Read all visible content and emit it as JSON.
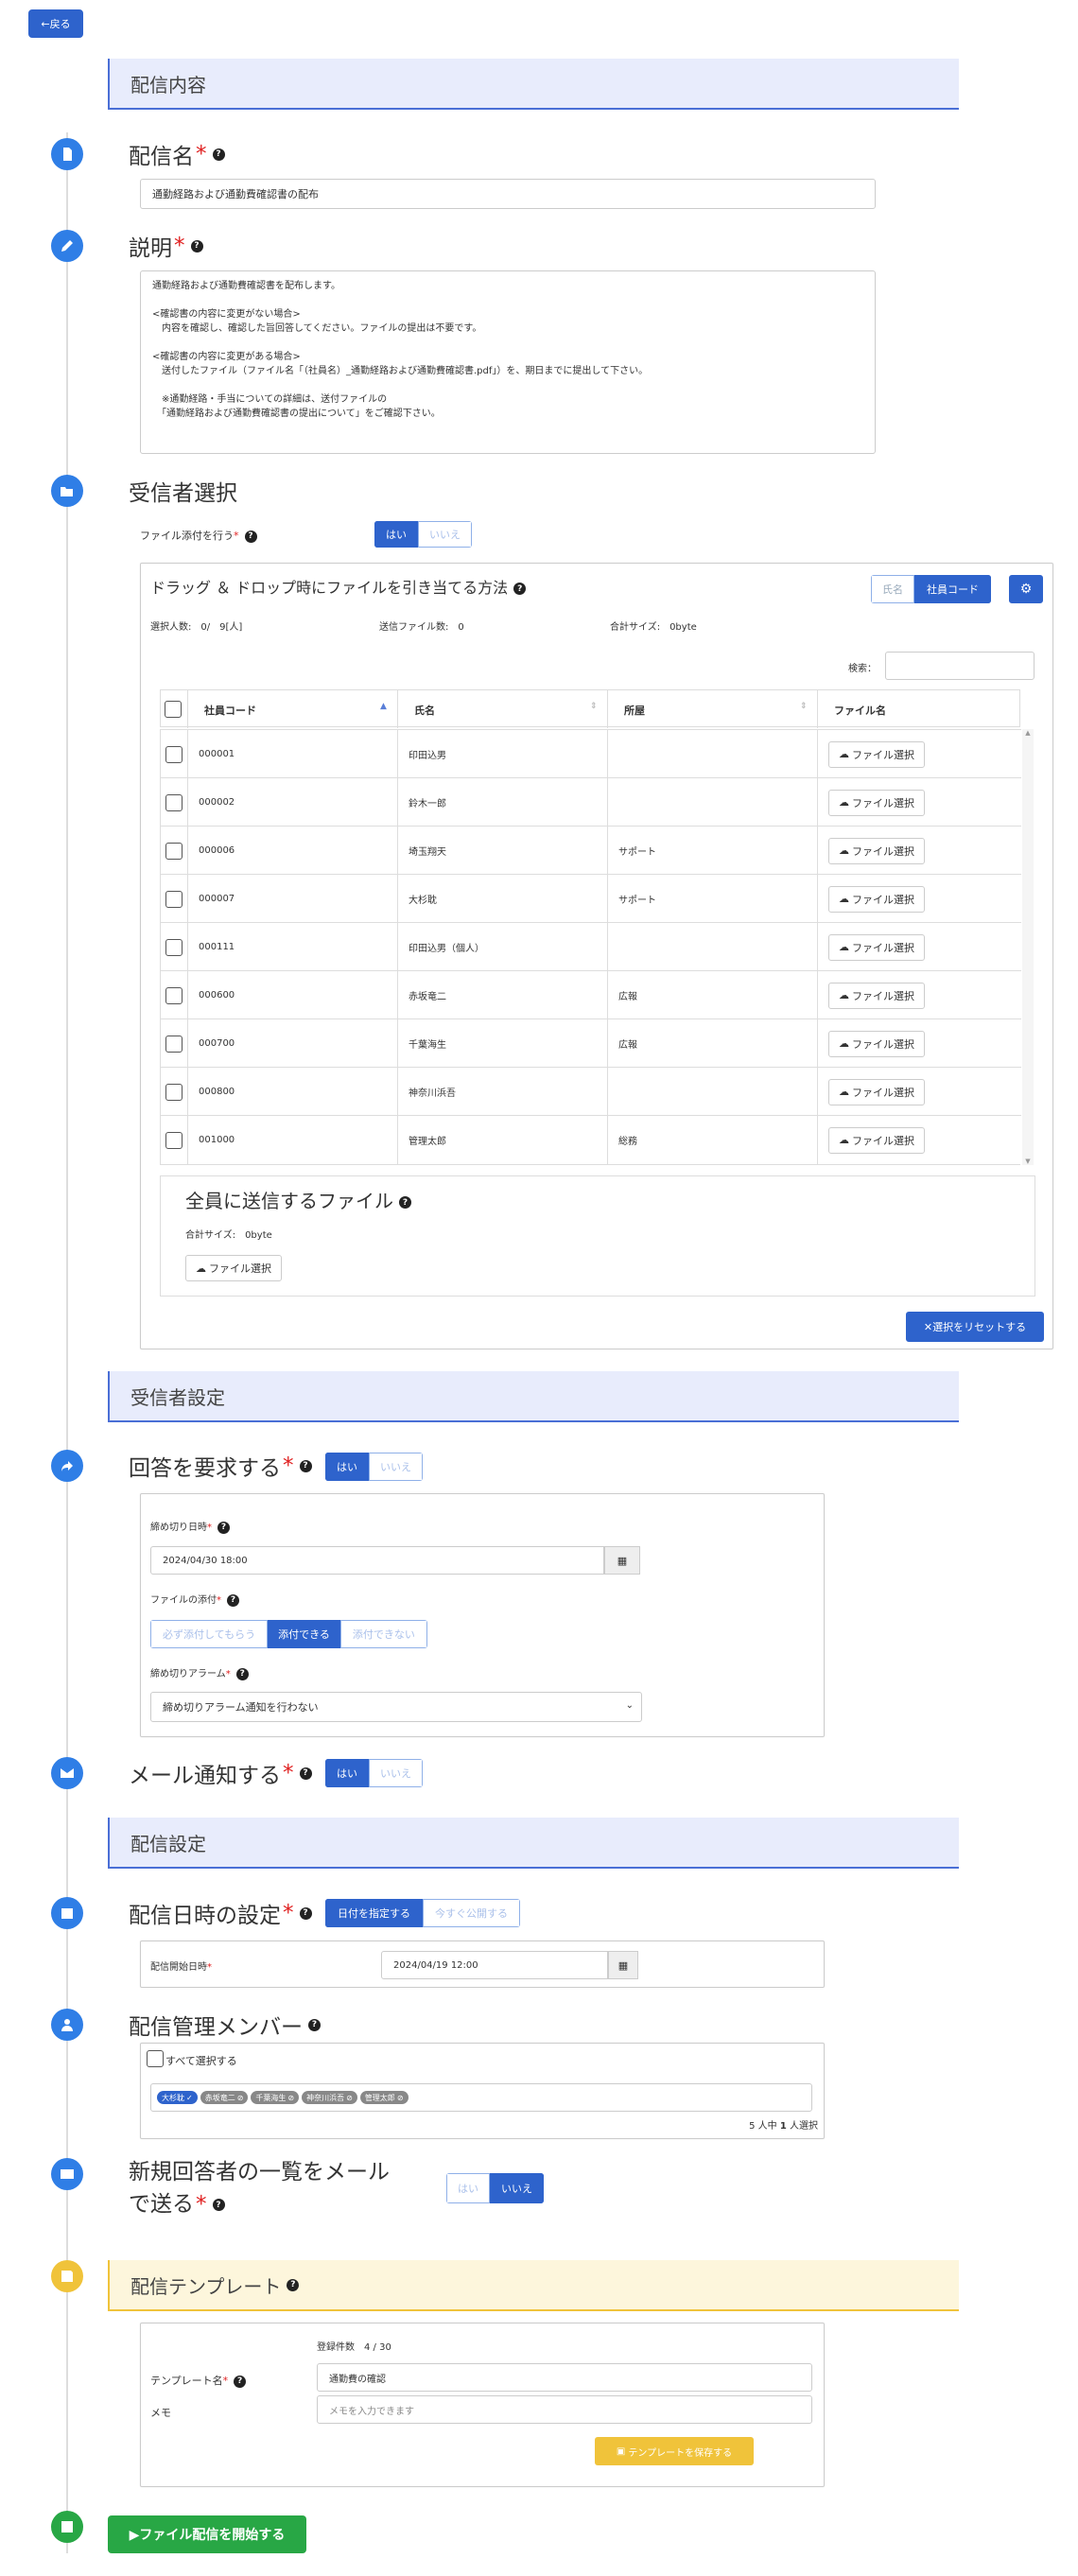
{
  "back_label": "←戻る",
  "sections": {
    "content": "配信内容",
    "recipient_settings": "受信者設定",
    "delivery_settings": "配信設定",
    "template": "配信テンプレート"
  },
  "delivery_name": {
    "label": "配信名",
    "value": "通勤経路および通勤費確認書の配布"
  },
  "description": {
    "label": "説明",
    "lines": [
      "通勤経路および通勤費確認書を配布します。",
      "",
      "<確認書の内容に変更がない場合>",
      "　内容を確認し、確認した旨回答してください。ファイルの提出は不要です。",
      "",
      "<確認書の内容に変更がある場合>",
      "　送付したファイル（ファイル名「（社員名）_通勤経路および通勤費確認書.pdf」）を、期日までに提出して下さい。",
      "",
      "　※通勤経路・手当についての詳細は、送付ファイルの",
      "　「通勤経路および通勤費確認書の提出について」をご確認下さい。"
    ]
  },
  "recipients": {
    "label": "受信者選択",
    "attach_label": "ファイル添付を行う",
    "yes": "はい",
    "no": "いいえ",
    "dd_title": "ドラッグ ＆ ドロップ時にファイルを引き当てる方法",
    "mode_name": "氏名",
    "mode_code": "社員コード",
    "selected_count": "選択人数:　0/　9[人]",
    "send_files": "送信ファイル数:　0",
    "total_size": "合計サイズ:　0byte",
    "search_label": "検索：",
    "columns": [
      "社員コード",
      "氏名",
      "所屋",
      "ファイル名"
    ],
    "file_button": "ファイル選択",
    "rows": [
      {
        "code": "000001",
        "name": "印田込男",
        "dept": ""
      },
      {
        "code": "000002",
        "name": "鈴木一郎",
        "dept": ""
      },
      {
        "code": "000006",
        "name": "埼玉翔天",
        "dept": "サポート"
      },
      {
        "code": "000007",
        "name": "大杉耽",
        "dept": "サポート"
      },
      {
        "code": "000111",
        "name": "印田込男（個人）",
        "dept": ""
      },
      {
        "code": "000600",
        "name": "赤坂竜二",
        "dept": "広報"
      },
      {
        "code": "000700",
        "name": "千葉海生",
        "dept": "広報"
      },
      {
        "code": "000800",
        "name": "神奈川浜吾",
        "dept": ""
      },
      {
        "code": "001000",
        "name": "管理太郎",
        "dept": "総務"
      }
    ],
    "all_files_title": "全員に送信するファイル",
    "all_files_size": "合計サイズ:　0byte",
    "reset_button": "✕選択をリセットする"
  },
  "require_answer": {
    "label": "回答を要求する",
    "deadline_label": "締め切り日時",
    "deadline_value": "2024/04/30 18:00",
    "attach_label": "ファイルの添付",
    "attach_options": [
      "必ず添付してもらう",
      "添付できる",
      "添付できない"
    ],
    "alarm_label": "締め切りアラーム",
    "alarm_value": "締め切りアラーム通知を行わない"
  },
  "mail_notify": {
    "label": "メール通知する"
  },
  "schedule": {
    "label": "配信日時の設定",
    "opt_date": "日付を指定する",
    "opt_now": "今すぐ公開する",
    "start_label": "配信開始日時",
    "start_value": "2024/04/19 12:00"
  },
  "members": {
    "label": "配信管理メンバー",
    "select_all": "すべて選択する",
    "tags": [
      "大杉耽",
      "赤坂竜二",
      "千葉海生",
      "神奈川浜吾",
      "管理太郎"
    ],
    "summary_pre": "5 人中 ",
    "summary_num": "1",
    "summary_post": " 人選択"
  },
  "new_list": {
    "label_1": "新規回答者の一覧をメール",
    "label_2": "で送る"
  },
  "template": {
    "count": "登録件数　4 / 30",
    "name_label": "テンプレート名",
    "name_value": "通勤費の確認",
    "memo_label": "メモ",
    "memo_placeholder": "メモを入力できます",
    "save_button": "テンプレートを保存する"
  },
  "start_button": "▶ファイル配信を開始する",
  "colors": {
    "primary": "#2e63cc",
    "timeline": "#2f7ee6",
    "success": "#28a745",
    "warning": "#f0c33a"
  }
}
